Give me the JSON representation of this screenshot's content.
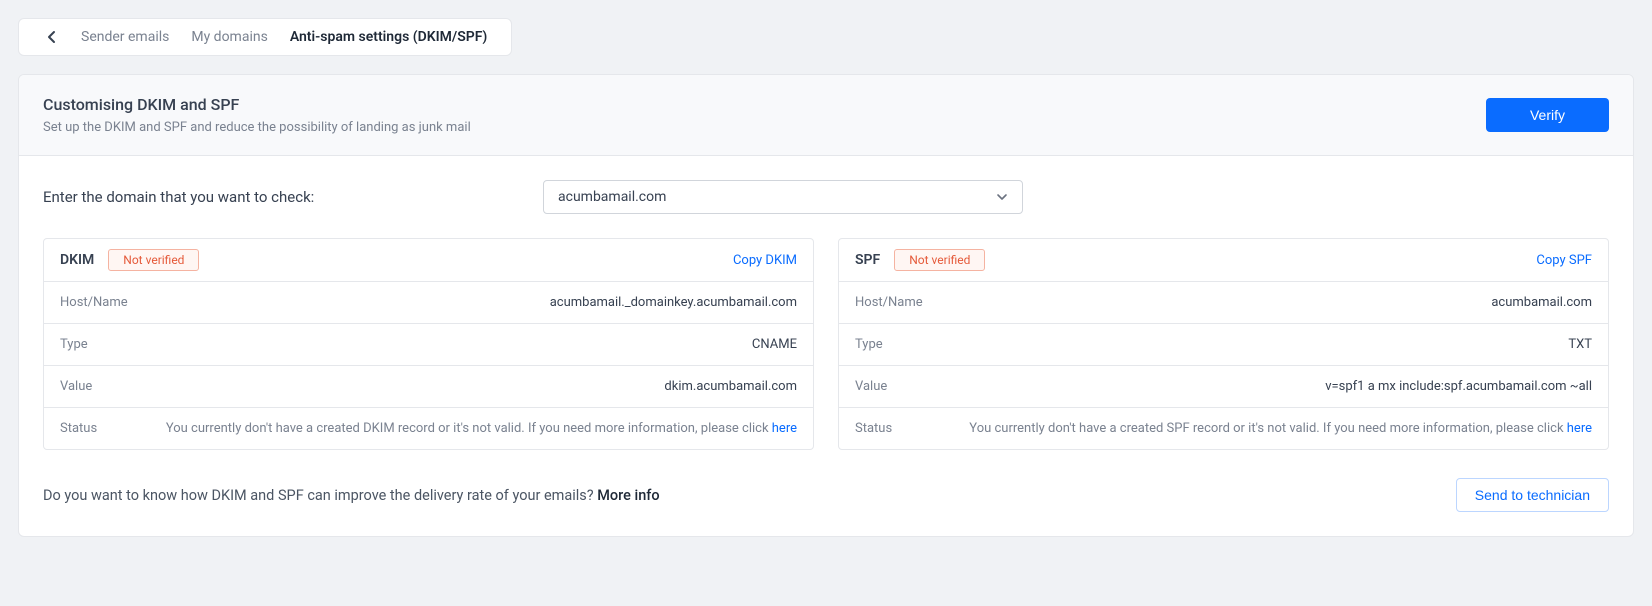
{
  "tabs": {
    "sender_emails": "Sender emails",
    "my_domains": "My domains",
    "antispam": "Anti-spam settings (DKIM/SPF)"
  },
  "header": {
    "title": "Customising DKIM and SPF",
    "subtitle": "Set up the DKIM and SPF and reduce the possibility of landing as junk mail",
    "verify_button": "Verify"
  },
  "domain": {
    "prompt": "Enter the domain that you want to check:",
    "selected": "acumbamail.com"
  },
  "labels": {
    "host": "Host/Name",
    "type": "Type",
    "value": "Value",
    "status": "Status",
    "here": "here"
  },
  "dkim": {
    "title": "DKIM",
    "badge": "Not verified",
    "copy": "Copy DKIM",
    "host": "acumbamail._domainkey.acumbamail.com",
    "type": "CNAME",
    "value": "dkim.acumbamail.com",
    "status_text": "You currently don't have a created DKIM record or it's not valid. If you need more information, please click "
  },
  "spf": {
    "title": "SPF",
    "badge": "Not verified",
    "copy": "Copy SPF",
    "host": "acumbamail.com",
    "type": "TXT",
    "value": "v=spf1 a mx include:spf.acumbamail.com ~all",
    "status_text": "You currently don't have a created SPF record or it's not valid. If you need more information, please click "
  },
  "footer": {
    "question": "Do you want to know how DKIM and SPF can improve the delivery rate of your emails? ",
    "more_info": "More info",
    "send_button": "Send to technician"
  }
}
